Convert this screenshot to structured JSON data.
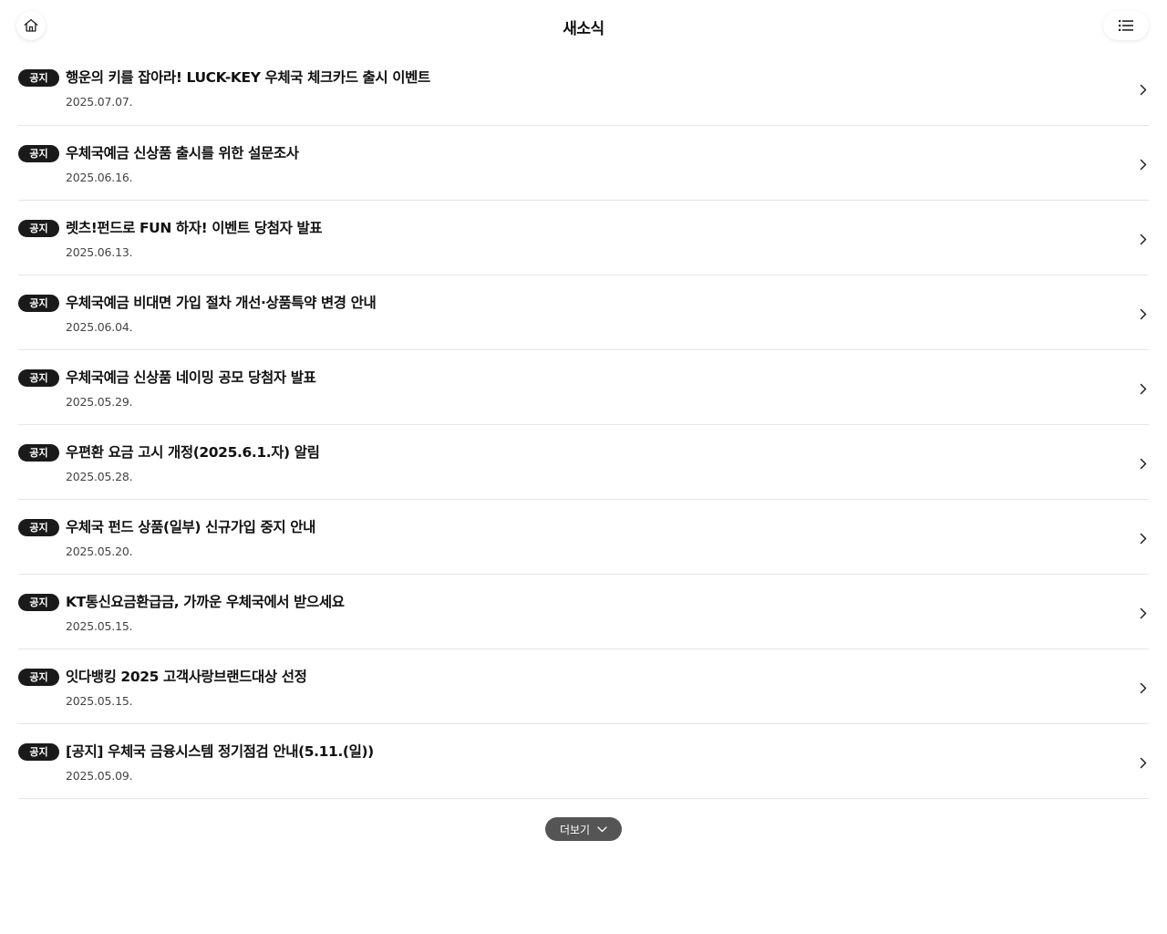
{
  "header": {
    "title": "새소식",
    "home_icon": "home-icon",
    "menu_icon": "list-menu-icon"
  },
  "news": {
    "items": [
      {
        "badge": "공지",
        "title": "행운의 키를 잡아라! LUCK-KEY 우체국 체크카드 출시 이벤트",
        "date": "2025.07.07."
      },
      {
        "badge": "공지",
        "title": "우체국예금 신상품 출시를 위한 설문조사",
        "date": "2025.06.16."
      },
      {
        "badge": "공지",
        "title": "렛츠!펀드로 FUN 하자! 이벤트 당첨자 발표",
        "date": "2025.06.13."
      },
      {
        "badge": "공지",
        "title": "우체국예금 비대면 가입 절차 개선·상품특약 변경 안내",
        "date": "2025.06.04."
      },
      {
        "badge": "공지",
        "title": "우체국예금 신상품 네이밍 공모 당첨자 발표",
        "date": "2025.05.29."
      },
      {
        "badge": "공지",
        "title": "우편환 요금 고시 개정(2025.6.1.자) 알림",
        "date": "2025.05.28."
      },
      {
        "badge": "공지",
        "title": "우체국 펀드 상품(일부) 신규가입 중지 안내",
        "date": "2025.05.20."
      },
      {
        "badge": "공지",
        "title": "KT통신요금환급금, 가까운 우체국에서 받으세요",
        "date": "2025.05.15."
      },
      {
        "badge": "공지",
        "title": "잇다뱅킹 2025 고객사랑브랜드대상 선정",
        "date": "2025.05.15."
      },
      {
        "badge": "공지",
        "title": "[공지] 우체국 금융시스템 정기점검 안내(5.11.(일))",
        "date": "2025.05.09."
      }
    ]
  },
  "more": {
    "label": "더보기",
    "icon": "chevron-down-icon"
  },
  "colors": {
    "badge_bg": "#1a1a1a",
    "more_bg": "#555555",
    "divider": "#e6e6e6"
  }
}
